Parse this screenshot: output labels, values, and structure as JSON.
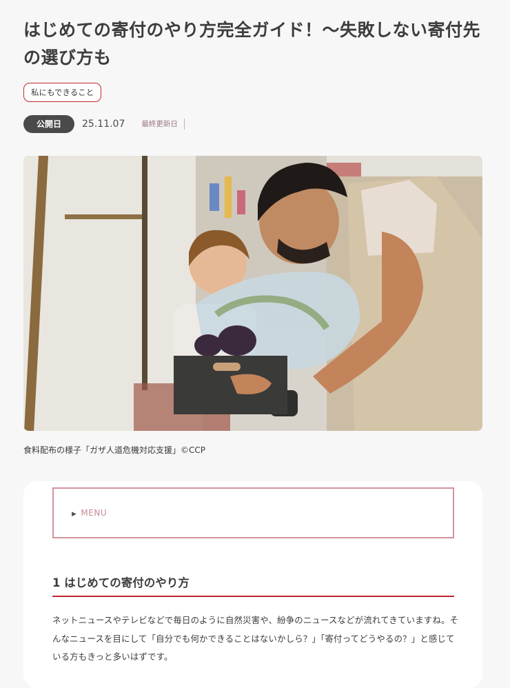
{
  "article": {
    "title": "はじめての寄付のやり方完全ガイド！〜失敗しない寄付先の選び方も",
    "tag": "私にもできること",
    "published_label": "公開日",
    "published_date": "25.11.07",
    "updated_label": "最終更新日",
    "photo_caption": "食料配布の様子「ガザ人道危機対応支援」©CCP"
  },
  "toc": {
    "arrow": "▶",
    "label": "MENU"
  },
  "section1": {
    "heading": "1 はじめての寄付のやり方",
    "paragraph": "ネットニュースやテレビなどで毎日のように自然災害や、紛争のニュースなどが流れてきていますね。そんなニュースを目にして「自分でも何かできることはないかしら？」「寄付ってどうやるの？」と感じている方もきっと多いはずです。"
  },
  "colors": {
    "accent_red": "#c1272d",
    "menu_pink": "#d5919c",
    "badge_dark": "#4a4a4a"
  }
}
